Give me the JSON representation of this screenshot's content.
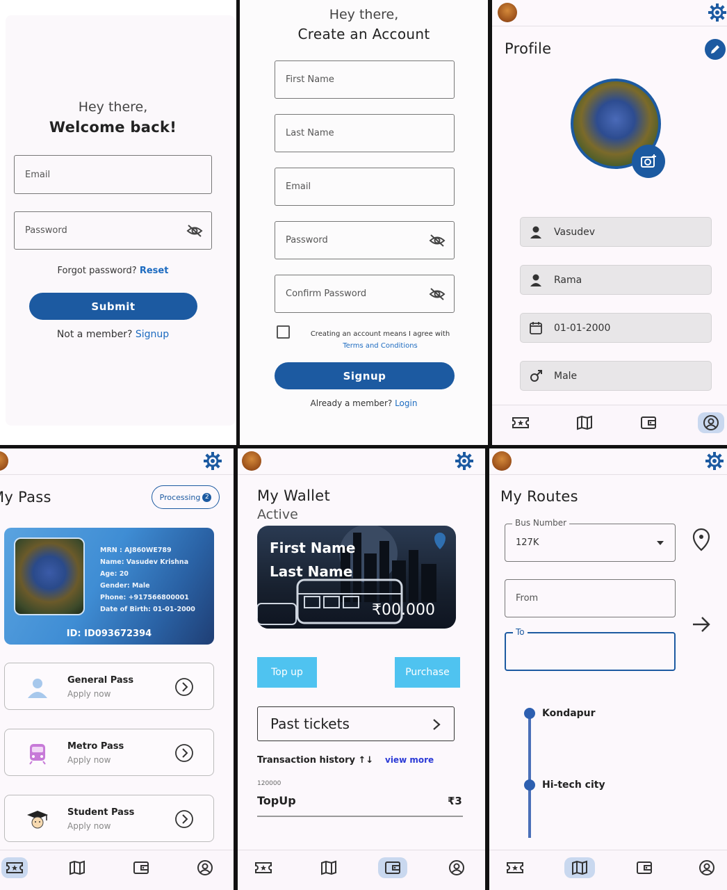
{
  "login": {
    "greeting": "Hey there,",
    "title": "Welcome back!",
    "email_placeholder": "Email",
    "password_placeholder": "Password",
    "forgot_text": "Forgot password?",
    "reset_link": "Reset",
    "submit_label": "Submit",
    "not_member_text": "Not a member?",
    "signup_link": "Signup"
  },
  "signup": {
    "greeting": "Hey there,",
    "title": "Create an Account",
    "first_name_placeholder": "First Name",
    "last_name_placeholder": "Last Name",
    "email_placeholder": "Email",
    "password_placeholder": "Password",
    "confirm_password_placeholder": "Confirm Password",
    "terms_text": "Creating an account means I agree with",
    "terms_link": "Terms and Conditions",
    "signup_label": "Signup",
    "already_member_text": "Already a member?",
    "login_link": "Login"
  },
  "profile": {
    "title": "Profile",
    "first_name": "Vasudev",
    "last_name": "Rama",
    "dob": "01-01-2000",
    "gender": "Male"
  },
  "my_pass": {
    "title": "My Pass",
    "status_badge": "Processing",
    "status_count": "2",
    "card": {
      "mrn": "MRN : AJ860WE789",
      "name": "Name: Vasudev Krishna",
      "age": "Age: 20",
      "gender": "Gender: Male",
      "phone": "Phone: +917566800001",
      "dob": "Date of Birth: 01-01-2000",
      "id": "ID: ID093672394"
    },
    "options": [
      {
        "name": "General Pass",
        "sub": "Apply now"
      },
      {
        "name": "Metro Pass",
        "sub": "Apply now"
      },
      {
        "name": "Student Pass",
        "sub": "Apply now"
      }
    ]
  },
  "wallet": {
    "title": "My Wallet",
    "status": "Active",
    "first_name": "First Name",
    "last_name": "Last Name",
    "amount": "₹00.000",
    "topup_label": "Top up",
    "purchase_label": "Purchase",
    "past_tickets_label": "Past tickets",
    "history_title": "Transaction history ↑↓",
    "view_more": "view more",
    "transaction": {
      "id": "120000",
      "type": "TopUp",
      "amount": "₹3"
    }
  },
  "routes": {
    "title": "My Routes",
    "bus_number_label": "Bus Number",
    "bus_number_value": "127K",
    "from_placeholder": "From",
    "to_label": "To",
    "stops": [
      "Kondapur",
      "Hi-tech city"
    ]
  },
  "colors": {
    "primary": "#1c5aa1",
    "accent_light": "#4fc3f0",
    "nav_active": "#c9d8ef"
  }
}
